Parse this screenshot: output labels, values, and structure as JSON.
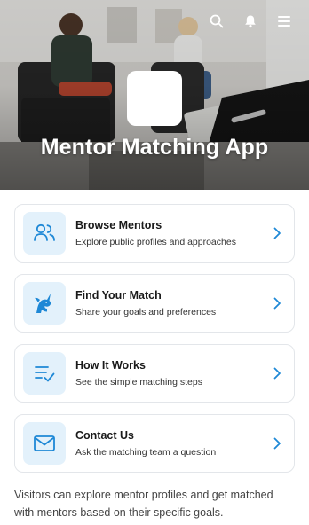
{
  "hero": {
    "title": "Mentor Matching App"
  },
  "header_icons": [
    "search-icon",
    "notification-bell-icon",
    "menu-icon"
  ],
  "colors": {
    "accent": "#1e88d6",
    "icon_background": "#e3f1fb",
    "card_border": "#e3e6ea"
  },
  "cards": [
    {
      "title": "Browse Mentors",
      "subtitle": "Explore public profiles and approaches",
      "icon": "users-icon"
    },
    {
      "title": "Find Your Match",
      "subtitle": "Share your goals and preferences",
      "icon": "unicorn-icon"
    },
    {
      "title": "How It Works",
      "subtitle": "See the simple matching steps",
      "icon": "list-check-icon"
    },
    {
      "title": "Contact Us",
      "subtitle": "Ask the matching team a question",
      "icon": "envelope-icon"
    }
  ],
  "footer": {
    "description": "Visitors can explore mentor profiles and get matched with mentors based on their specific goals."
  }
}
